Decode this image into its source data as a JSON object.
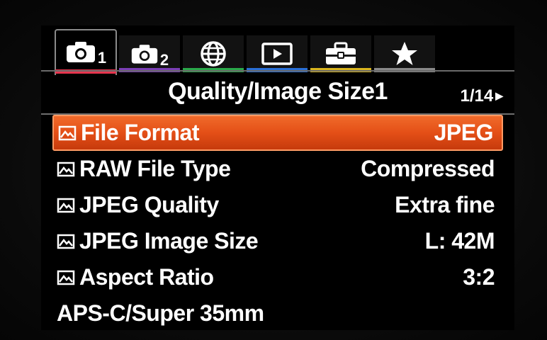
{
  "tabs": [
    {
      "name": "camera-settings-1",
      "icon": "camera-icon",
      "sub": "1",
      "color": "#e8354e",
      "active": true
    },
    {
      "name": "camera-settings-2",
      "icon": "camera-icon",
      "sub": "2",
      "color": "#7b3fb6",
      "active": false
    },
    {
      "name": "network",
      "icon": "globe-icon",
      "sub": "",
      "color": "#2aa84a",
      "active": false
    },
    {
      "name": "playback",
      "icon": "playback-icon",
      "sub": "",
      "color": "#2a6fd6",
      "active": false
    },
    {
      "name": "setup",
      "icon": "toolbox-icon",
      "sub": "",
      "color": "#d9b51e",
      "active": false
    },
    {
      "name": "my-menu",
      "icon": "star-icon",
      "sub": "",
      "color": "#8a8a8a",
      "active": false
    }
  ],
  "header": {
    "title": "Quality/Image Size1",
    "page": "1/14"
  },
  "menu": {
    "items": [
      {
        "label": "File Format",
        "value": "JPEG",
        "icon": "still-image-icon",
        "selected": true
      },
      {
        "label": "RAW File Type",
        "value": "Compressed",
        "icon": "still-image-icon",
        "selected": false
      },
      {
        "label": "JPEG Quality",
        "value": "Extra fine",
        "icon": "still-image-icon",
        "selected": false
      },
      {
        "label": "JPEG Image Size",
        "value": "L: 42M",
        "icon": "still-image-icon",
        "selected": false
      },
      {
        "label": "Aspect Ratio",
        "value": "3:2",
        "icon": "still-image-icon",
        "selected": false
      },
      {
        "label": "APS-C/Super 35mm",
        "value": "",
        "icon": "",
        "selected": false
      }
    ]
  },
  "colors": {
    "highlight": "#e44f17",
    "divider": "#6e6e6e"
  }
}
